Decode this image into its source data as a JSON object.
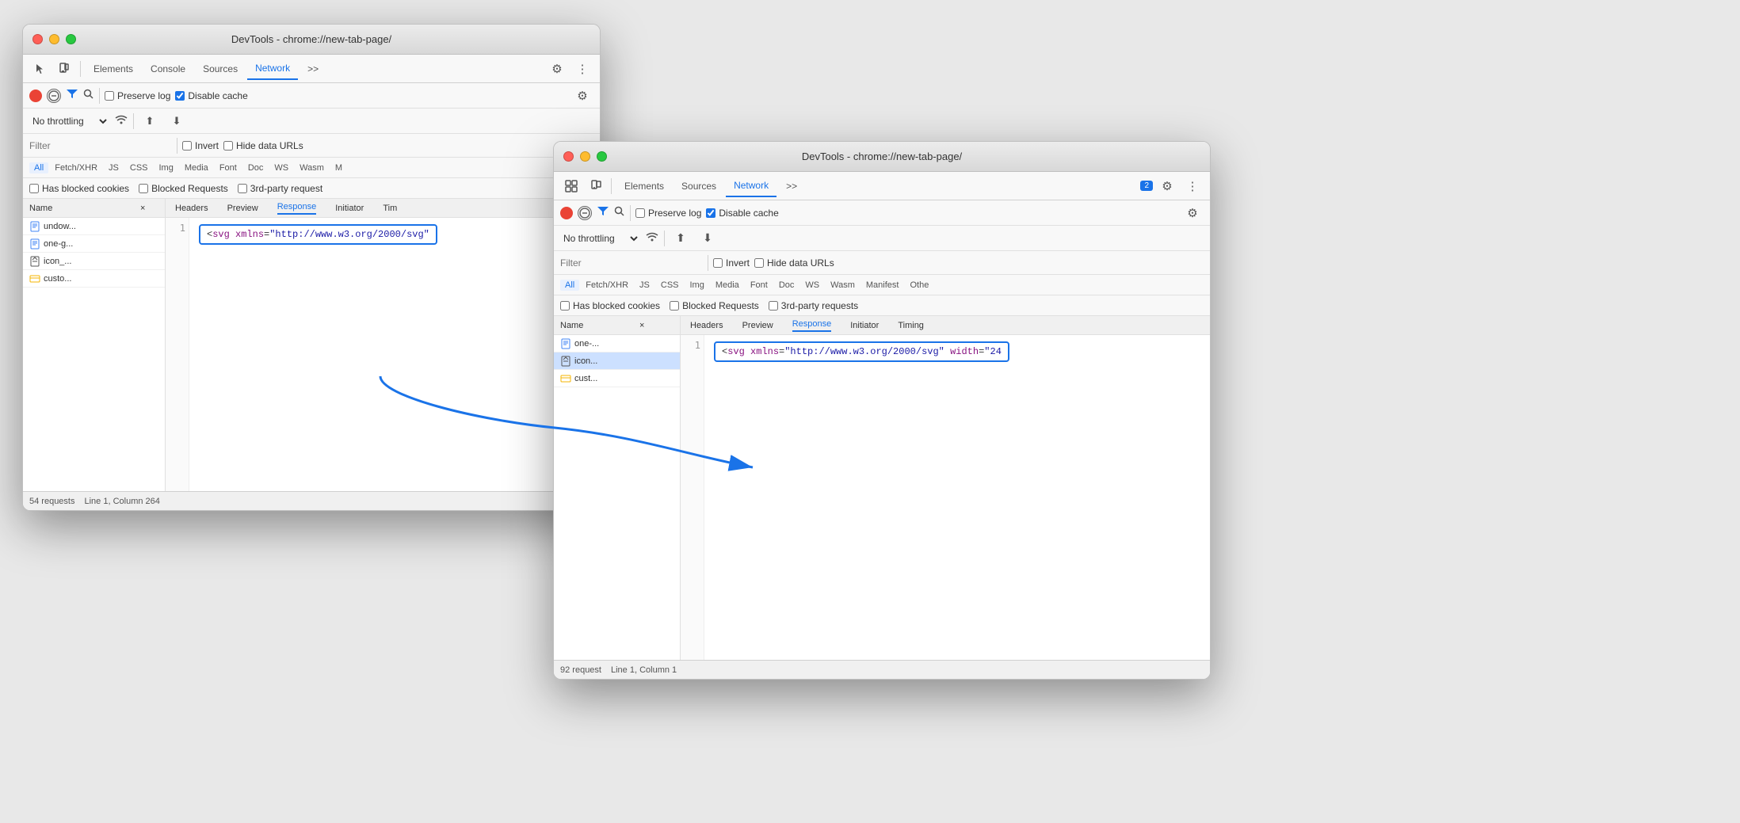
{
  "window1": {
    "title": "DevTools - chrome://new-tab-page/",
    "tabs": {
      "elements": "Elements",
      "console": "Console",
      "sources": "Sources",
      "network": "Network",
      "more": ">>"
    },
    "toolbar": {
      "preserve_log": "Preserve log",
      "disable_cache": "Disable cache",
      "throttling": "No throttling"
    },
    "filter": {
      "placeholder": "Filter",
      "invert": "Invert",
      "hide_data": "Hide data URLs"
    },
    "type_filters": [
      "All",
      "Fetch/XHR",
      "JS",
      "CSS",
      "Img",
      "Media",
      "Font",
      "Doc",
      "WS",
      "Wasm",
      "M"
    ],
    "checkboxes": [
      "Has blocked cookies",
      "Blocked Requests",
      "3rd-party request"
    ],
    "columns": {
      "name": "Name",
      "x": "×",
      "headers": "Headers",
      "preview": "Preview",
      "response": "Response",
      "initiator": "Initiator",
      "tim": "Tim"
    },
    "rows": [
      {
        "icon": "page",
        "name": "undow...",
        "selected": false
      },
      {
        "icon": "page",
        "name": "one-g...",
        "selected": false
      },
      {
        "icon": "file",
        "name": "icon_...",
        "selected": false
      },
      {
        "icon": "resource",
        "name": "custo...",
        "selected": false
      }
    ],
    "response_text": "<svg xmlns=\"http://www.w3.org/2000/svg\"",
    "row_number": "1",
    "status_bar": {
      "requests": "54 requests",
      "position": "Line 1, Column 264"
    }
  },
  "window2": {
    "title": "DevTools - chrome://new-tab-page/",
    "tabs": {
      "elements": "Elements",
      "sources": "Sources",
      "network": "Network",
      "more": ">>",
      "badge": "2"
    },
    "toolbar": {
      "preserve_log": "Preserve log",
      "disable_cache": "Disable cache",
      "throttling": "No throttling"
    },
    "filter": {
      "placeholder": "Filter",
      "invert": "Invert",
      "hide_data": "Hide data URLs"
    },
    "type_filters": [
      "All",
      "Fetch/XHR",
      "JS",
      "CSS",
      "Img",
      "Media",
      "Font",
      "Doc",
      "WS",
      "Wasm",
      "Manifest",
      "Othe"
    ],
    "checkboxes": [
      "Has blocked cookies",
      "Blocked Requests",
      "3rd-party requests"
    ],
    "columns": {
      "name": "Name",
      "x": "×",
      "headers": "Headers",
      "preview": "Preview",
      "response": "Response",
      "initiator": "Initiator",
      "timing": "Timing"
    },
    "rows": [
      {
        "icon": "page",
        "name": "one-...",
        "selected": false
      },
      {
        "icon": "file",
        "name": "icon...",
        "selected": true
      },
      {
        "icon": "resource",
        "name": "cust...",
        "selected": false
      }
    ],
    "response_text": "<svg xmlns=\"http://www.w3.org/2000/svg\" width=\"24",
    "row_number": "1",
    "status_bar": {
      "requests": "92 request",
      "position": "Line 1, Column 1"
    }
  },
  "icons": {
    "record": "⏺",
    "clear": "🚫",
    "filter": "⚡",
    "search": "🔍",
    "upload": "⬆",
    "download": "⬇",
    "settings": "⚙",
    "more_options": "⋮",
    "pointer": "↖",
    "device": "📱",
    "wifi": "📶",
    "page_icon": "📄",
    "file_icon": "✏",
    "resource_icon": "⬡"
  }
}
